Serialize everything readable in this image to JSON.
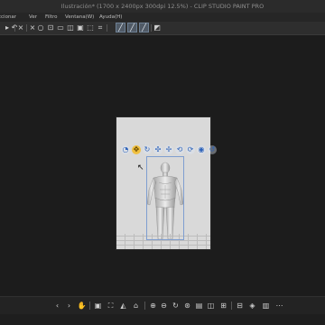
{
  "app": {
    "title": "Ilustración* (1700 x 2400px 300dpi 12.5%)  - CLIP STUDIO PAINT PRO"
  },
  "menu": {
    "items": [
      "ccionar",
      "Ver",
      "Filtro",
      "Ventana(W)",
      "Ayuda(H)"
    ]
  },
  "toolbar": {
    "icons": [
      "selection-icon",
      "hand-icon",
      "transform-icon",
      "move-icon",
      "undo-icon",
      "redo-icon",
      "clear-icon",
      "lasso-icon",
      "rect-select-icon",
      "select-all-icon",
      "crop-icon",
      "fill-icon",
      "brush-icon",
      "eraser-icon",
      "snap-icon",
      "ruler-icon",
      "perspective-icon",
      "grid-icon"
    ],
    "toggles": [
      "snap-line-toggle",
      "snap-ruler-toggle",
      "snap-grid-toggle"
    ]
  },
  "canvas": {
    "background": "#1c1c1c",
    "paper_color": "#d9d9d9"
  },
  "object_launcher": {
    "icons": [
      "camera-icon",
      "move-icon",
      "rotate-icon",
      "pan-icon",
      "zoom-icon",
      "rotate-x-icon",
      "rotate-y-icon",
      "rotate-z-icon",
      "pose-icon",
      "reset-icon"
    ]
  },
  "navigator": {
    "icons": [
      "prev-icon",
      "next-icon",
      "hand-tool-icon",
      "camera-rotate-icon",
      "zoom-in-icon",
      "zoom-out-icon",
      "fit-icon",
      "rotate-left-icon",
      "rotate-right-icon",
      "flip-icon",
      "menu-icon",
      "layers-icon",
      "rulers-icon",
      "grid-icon",
      "perspective-icon"
    ]
  },
  "colors": {
    "accent": "#2d62b9",
    "selection": "#7f9ed0"
  }
}
